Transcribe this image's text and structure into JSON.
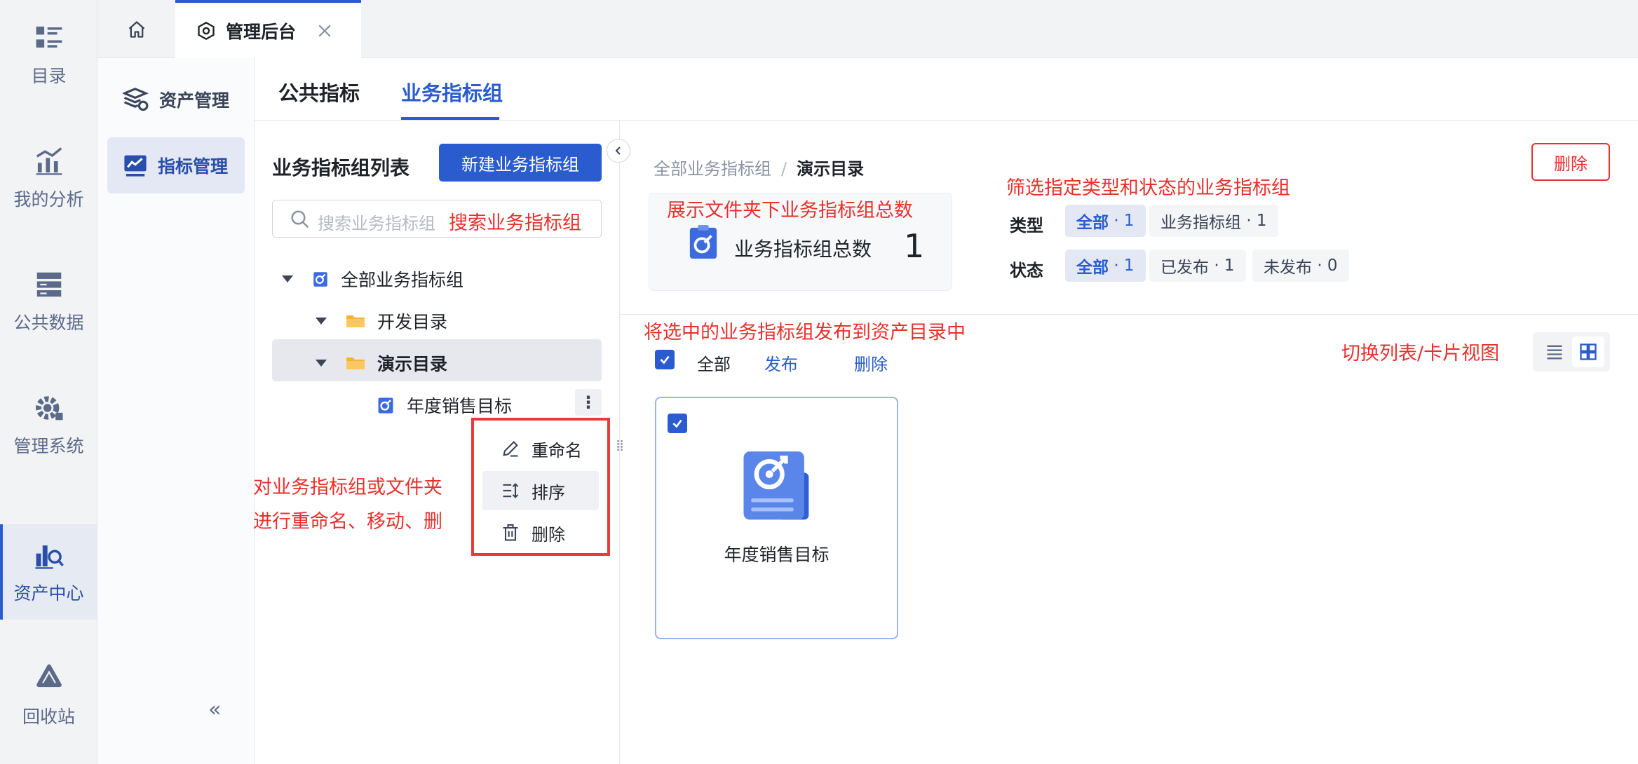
{
  "leftnav": {
    "items": [
      {
        "label": "目录",
        "icon": "catalog-icon"
      },
      {
        "label": "我的分析",
        "icon": "analysis-chart-icon"
      },
      {
        "label": "公共数据",
        "icon": "database-icon"
      },
      {
        "label": "管理系统",
        "icon": "gear-icon"
      },
      {
        "label": "资产中心",
        "icon": "asset-search-icon",
        "active": true
      },
      {
        "label": "回收站",
        "icon": "recycle-icon"
      }
    ]
  },
  "tabbar": {
    "home_icon": "home-icon",
    "active_tab_label": "管理后台",
    "active_tab_icon": "hexagon-settings-icon",
    "close_icon": "close-icon"
  },
  "submenu": {
    "items": [
      {
        "label": "资产管理",
        "icon": "asset-stack-icon"
      },
      {
        "label": "指标管理",
        "icon": "metric-chart-icon",
        "active": true
      }
    ],
    "collapse_label": "«"
  },
  "main_tabs": [
    {
      "label": "公共指标"
    },
    {
      "label": "业务指标组",
      "active": true
    }
  ],
  "list_panel": {
    "title": "业务指标组列表",
    "new_button": "新建业务指标组",
    "search_placeholder": "搜索业务指标组",
    "tree": {
      "root": "全部业务指标组",
      "folder1": "开发目录",
      "folder2": "演示目录",
      "leaf": "年度销售目标"
    },
    "more_label": "⋮",
    "context_menu": {
      "rename": "重命名",
      "sort": "排序",
      "delete": "删除"
    }
  },
  "annotations": {
    "search": "搜索业务指标组",
    "context_line1": "对业务指标组或文件夹",
    "context_line2": "进行重命名、移动、删",
    "total": "展示文件夹下业务指标组总数",
    "filter": "筛选指定类型和状态的业务指标组",
    "publish": "将选中的业务指标组发布到资产目录中",
    "view_switch": "切换列表/卡片视图"
  },
  "content": {
    "breadcrumb_root": "全部业务指标组",
    "breadcrumb_sep": "/",
    "breadcrumb_current": "演示目录",
    "delete_button": "删除",
    "total_label": "业务指标组总数",
    "total_count": "1",
    "filters": {
      "type_key": "类型",
      "type_chips": [
        {
          "label": "全部",
          "count": "· 1",
          "active": true
        },
        {
          "label": "业务指标组",
          "count": "· 1"
        }
      ],
      "status_key": "状态",
      "status_chips": [
        {
          "label": "全部",
          "count": "· 1",
          "active": true
        },
        {
          "label": "已发布",
          "count": "· 1"
        },
        {
          "label": "未发布",
          "count": "· 0"
        }
      ]
    },
    "select_all_label": "全部",
    "publish_link": "发布",
    "delete_link": "删除",
    "card_title": "年度销售目标"
  },
  "colors": {
    "accent": "#2a5ccf",
    "annotation_red": "#e8302c",
    "nav_bg": "#f2f3f5"
  }
}
